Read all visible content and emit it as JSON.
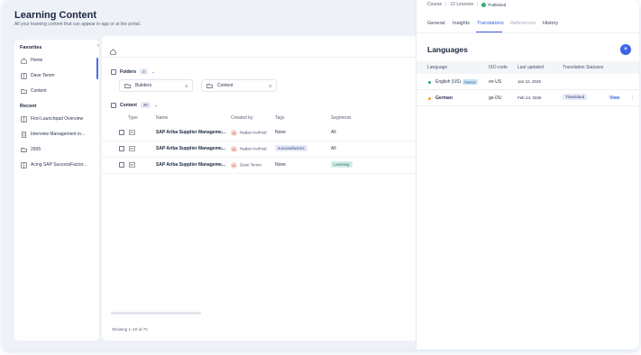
{
  "page": {
    "title": "Learning Content",
    "subtitle": "All your learning content that can appear in-app or at the portal."
  },
  "sidebar": {
    "favorites_label": "Favorites",
    "favorites": [
      {
        "label": "Home",
        "icon": "home-icon"
      },
      {
        "label": "Dave Temm",
        "icon": "book-icon"
      },
      {
        "label": "Content",
        "icon": "folder-icon"
      }
    ],
    "recent_label": "Recent",
    "recent": [
      {
        "label": "Fiori Launchpad Overview",
        "icon": "book-icon"
      },
      {
        "label": "Interview Management in...",
        "icon": "doc-icon"
      },
      {
        "label": "2505",
        "icon": "folder-icon"
      },
      {
        "label": "Acing SAP SuccessFactor...",
        "icon": "book-icon"
      }
    ]
  },
  "folders": {
    "label": "Folders",
    "count": "3",
    "items": [
      {
        "name": "Builders",
        "count": "5"
      },
      {
        "name": "Content",
        "count": "0"
      }
    ]
  },
  "content": {
    "label": "Content",
    "count": "20",
    "columns": {
      "type": "Type",
      "name": "Name",
      "created_by": "Created by",
      "tags": "Tags",
      "segments": "Segments"
    },
    "rows": [
      {
        "name": "SAP Ariba Supplier Manageme...",
        "initials": "NK",
        "creator": "Nadav Kerlmal",
        "tag": "None",
        "segment": "All"
      },
      {
        "name": "SAP Ariba Supplier Manageme...",
        "initials": "NK",
        "creator": "Nadav Kerlmal",
        "tag": "successfactors",
        "segment": "All"
      },
      {
        "name": "SAP Ariba Supplier Manageme...",
        "initials": "DT",
        "creator": "Dave Temm",
        "tag": "None",
        "segment": "Learning"
      }
    ],
    "showing": "Showing 1–10 of 72"
  },
  "panel": {
    "course_label": "Course",
    "lessons": "12 Lessons",
    "status": "Published",
    "tabs": [
      "General",
      "Insights",
      "Translations",
      "References",
      "History"
    ],
    "active_tab": "Translations",
    "languages_title": "Languages",
    "add_label": "+",
    "columns": {
      "language": "Language",
      "iso": "ISO code",
      "updated": "Last updated",
      "status": "Translation Statuses"
    },
    "rows": [
      {
        "language": "English (US)",
        "badge": "Source",
        "iso": "en-US",
        "updated": "Jan 10, 2026",
        "status": "",
        "action": "",
        "dot_color": "#2ba46f"
      },
      {
        "language": "German",
        "badge": "",
        "iso": "ge-DU",
        "updated": "Feb 24, 2026",
        "status": "Translated",
        "action": "View",
        "dot_color": "#f0a030"
      }
    ],
    "more_label": "⋮"
  }
}
